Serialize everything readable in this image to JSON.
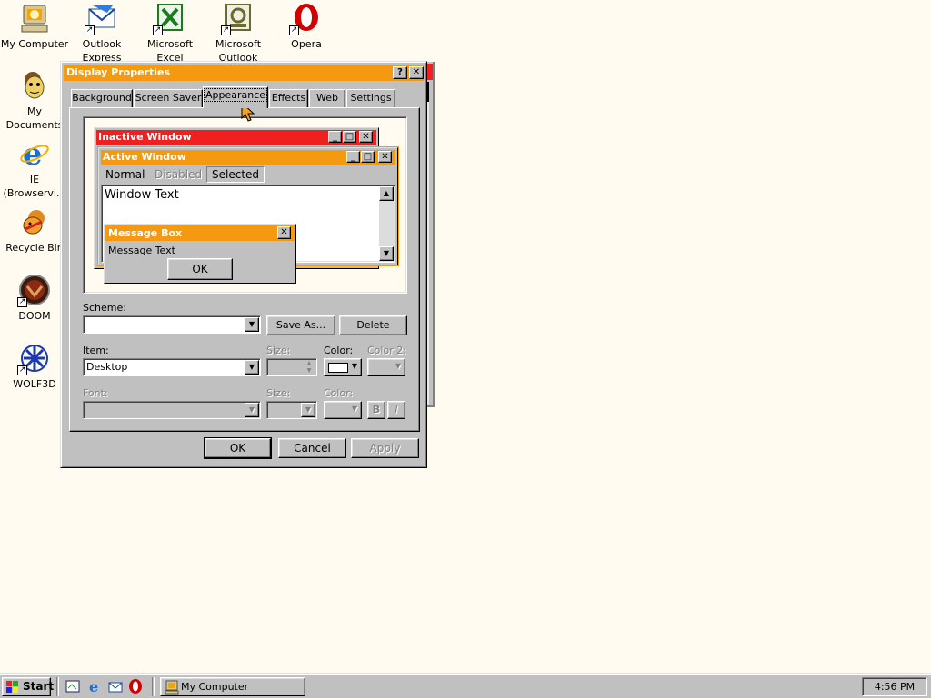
{
  "desktop": {
    "icons": [
      {
        "label": "My Computer",
        "icon": "my-computer-icon"
      },
      {
        "label": "Outlook\nExpress",
        "icon": "outlook-express-icon"
      },
      {
        "label": "Microsoft\nExcel",
        "icon": "excel-icon"
      },
      {
        "label": "Microsoft\nOutlook",
        "icon": "outlook-icon"
      },
      {
        "label": "Opera",
        "icon": "opera-icon"
      },
      {
        "label": "My\nDocuments",
        "icon": "my-documents-icon"
      },
      {
        "label": "IE\n(Browservi...",
        "icon": "ie-icon"
      },
      {
        "label": "Recycle Bin",
        "icon": "recycle-bin-icon"
      },
      {
        "label": "DOOM",
        "icon": "doom-icon"
      },
      {
        "label": "WOLF3D",
        "icon": "wolf3d-icon"
      }
    ]
  },
  "dialog": {
    "title": "Display Properties",
    "help_glyph": "?",
    "close_glyph": "✕",
    "tabs": [
      "Background",
      "Screen Saver",
      "Appearance",
      "Effects",
      "Web",
      "Settings"
    ],
    "active_tab": "Appearance",
    "preview": {
      "inactive_title": "Inactive Window",
      "active_title": "Active Window",
      "menu": {
        "normal": "Normal",
        "disabled": "Disabled",
        "selected": "Selected"
      },
      "window_text": "Window Text",
      "msgbox_title": "Message Box",
      "msgbox_text": "Message Text",
      "ok_label": "OK"
    },
    "scheme": {
      "label": "Scheme:",
      "value": "",
      "save_as_label": "Save As...",
      "delete_label": "Delete"
    },
    "item": {
      "label": "Item:",
      "value": "Desktop",
      "size_label": "Size:",
      "color_label": "Color:",
      "color2_label": "Color 2:",
      "color_value": "#ffffff"
    },
    "font": {
      "label": "Font:",
      "size_label": "Size:",
      "color_label": "Color:",
      "bold_label": "B",
      "italic_label": "I"
    },
    "buttons": {
      "ok": "OK",
      "cancel": "Cancel",
      "apply": "Apply"
    }
  },
  "taskbar": {
    "start_label": "Start",
    "quicklaunch": [
      "show-desktop-icon",
      "ie-icon",
      "outlook-express-icon",
      "opera-icon"
    ],
    "task_button_label": "My Computer",
    "clock": "4:56 PM"
  },
  "colors": {
    "desktop": "#fffbf0",
    "active_title": "#f59a10",
    "inactive_title": "#ee2020",
    "face": "#c0c0c0"
  }
}
